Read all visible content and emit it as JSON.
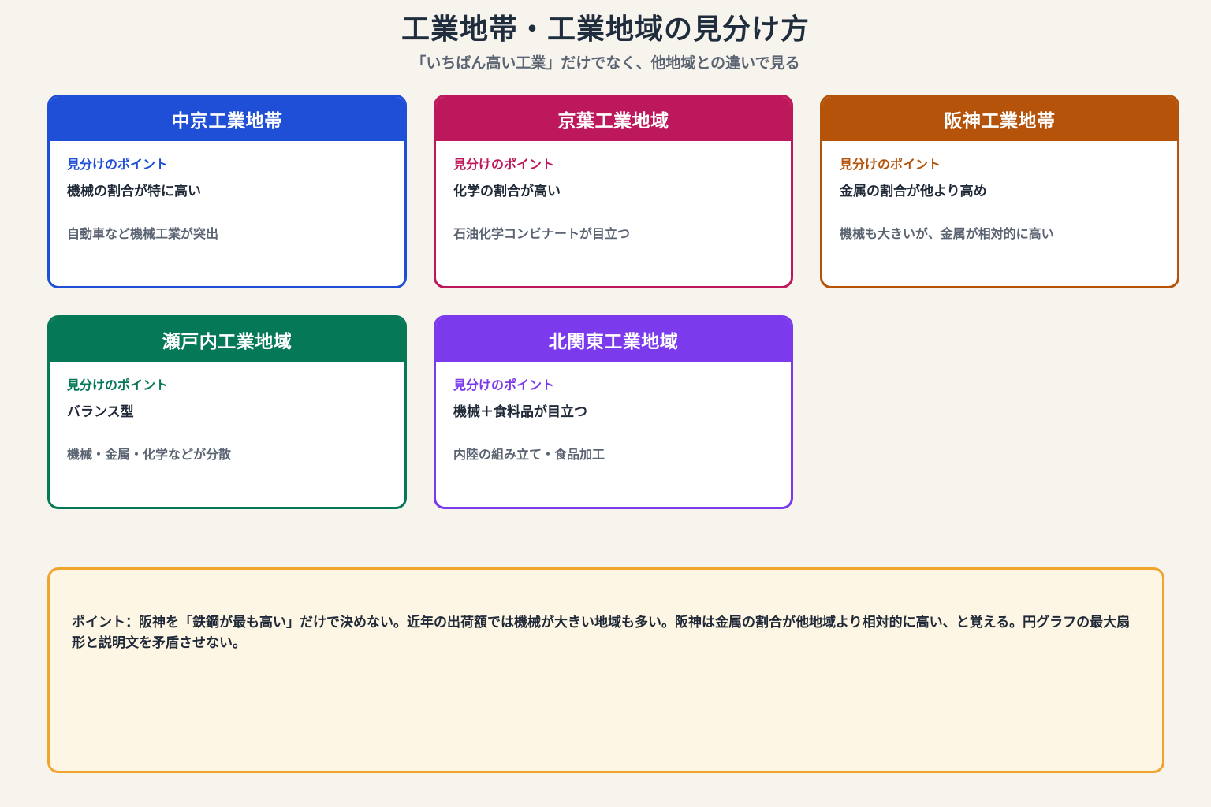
{
  "header": {
    "title": "工業地帯・工業地域の見分け方",
    "subtitle": "「いちばん高い工業」だけでなく、他地域との違いで見る"
  },
  "cards": [
    {
      "name": "中京工業地帯",
      "color": "#1f4fd6",
      "point_label": "見分けのポイント",
      "main": "機械の割合が特に高い",
      "detail": "自動車など機械工業が突出"
    },
    {
      "name": "京葉工業地域",
      "color": "#be185d",
      "point_label": "見分けのポイント",
      "main": "化学の割合が高い",
      "detail": "石油化学コンビナートが目立つ"
    },
    {
      "name": "阪神工業地帯",
      "color": "#b45309",
      "point_label": "見分けのポイント",
      "main": "金属の割合が他より高め",
      "detail": "機械も大きいが、金属が相対的に高い"
    },
    {
      "name": "瀬戸内工業地域",
      "color": "#047857",
      "point_label": "見分けのポイント",
      "main": "バランス型",
      "detail": "機械・金属・化学などが分散"
    },
    {
      "name": "北関東工業地域",
      "color": "#7c3aed",
      "point_label": "見分けのポイント",
      "main": "機械＋食料品が目立つ",
      "detail": "内陸の組み立て・食品加工"
    }
  ],
  "note": {
    "text": "ポイント：阪神を「鉄鋼が最も高い」だけで決めない。近年の出荷額では機械が大きい地域も多い。阪神は金属の割合が他地域より相対的に高い、と覚える。円グラフの最大扇形と説明文を矛盾させない。",
    "border_color": "#f0a42c",
    "background": "#fdf6e4"
  }
}
